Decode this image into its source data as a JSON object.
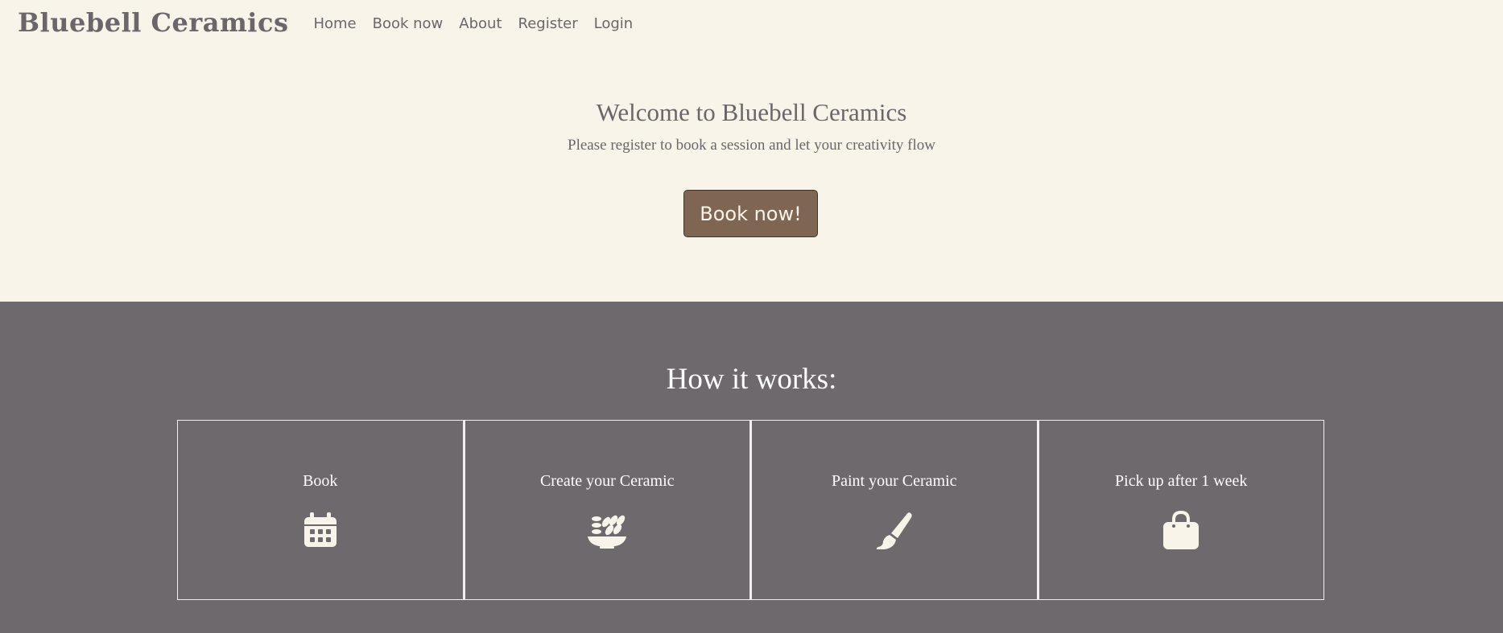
{
  "nav": {
    "brand": "Bluebell Ceramics",
    "links": [
      "Home",
      "Book now",
      "About",
      "Register",
      "Login"
    ]
  },
  "hero": {
    "title": "Welcome to Bluebell Ceramics",
    "subtitle": "Please register to book a session and let your creativity flow",
    "button_label": "Book now!"
  },
  "how_it_works": {
    "title": "How it works:",
    "steps": [
      {
        "label": "Book",
        "icon": "calendar-icon"
      },
      {
        "label": "Create your Ceramic",
        "icon": "bowl-icon"
      },
      {
        "label": "Paint your Ceramic",
        "icon": "paintbrush-icon"
      },
      {
        "label": "Pick up after 1 week",
        "icon": "shopping-bag-icon"
      }
    ]
  },
  "colors": {
    "background": "#f8f4e9",
    "text": "#6b6669",
    "accent_button": "#7e6653",
    "section_dark": "#6e696d"
  }
}
